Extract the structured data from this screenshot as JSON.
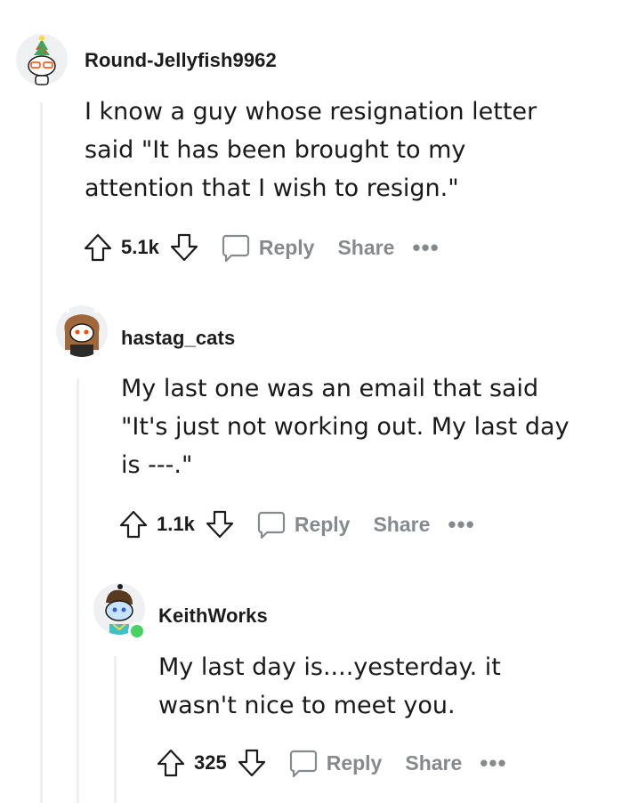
{
  "comments": [
    {
      "username": "Round-Jellyfish9962",
      "lines": [
        "I know a guy whose resignation letter",
        "said \"It has been brought to my",
        "attention that I wish to resign.\""
      ],
      "score": "5.1k",
      "reply": "Reply",
      "share": "Share",
      "more": "•••"
    },
    {
      "username": "hastag_cats",
      "lines": [
        "My last one was an email that said",
        "\"It's just not working out. My last day",
        "is ---.\""
      ],
      "score": "1.1k",
      "reply": "Reply",
      "share": "Share",
      "more": "•••"
    },
    {
      "username": "KeithWorks",
      "lines": [
        "My last day is....yesterday. it",
        "wasn't nice to meet you."
      ],
      "score": "325",
      "reply": "Reply",
      "share": "Share",
      "more": "•••"
    }
  ],
  "colors": {
    "muted": "#878a8c",
    "thread": "#edeff1",
    "online": "#46d160",
    "text": "#1c1c1c"
  },
  "icons": [
    "snoo-avatar",
    "upvote-arrow-icon",
    "downvote-arrow-icon",
    "comment-bubble-icon",
    "more-options-icon",
    "online-status-dot"
  ]
}
